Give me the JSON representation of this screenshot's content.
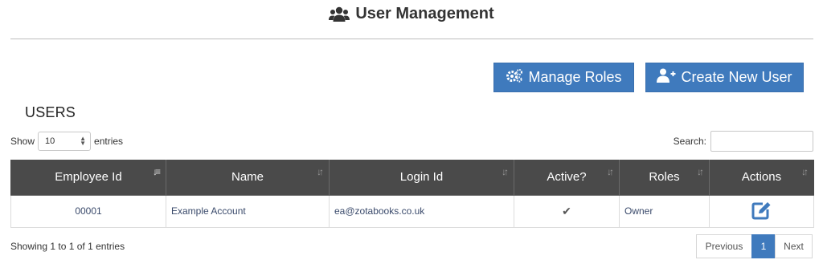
{
  "page": {
    "title": "User Management",
    "title_icon": "users-icon"
  },
  "actions": {
    "manage_roles_label": "Manage Roles",
    "manage_roles_icon": "gears-icon",
    "create_user_label": "Create New User",
    "create_user_icon": "user-plus-icon"
  },
  "section": {
    "title": "USERS"
  },
  "length_menu": {
    "prefix": "Show",
    "value": "10",
    "suffix": "entries"
  },
  "search": {
    "label": "Search:",
    "value": ""
  },
  "table": {
    "columns": [
      "Employee Id",
      "Name",
      "Login Id",
      "Active?",
      "Roles",
      "Actions"
    ],
    "sorted_column": "Employee Id",
    "rows": [
      {
        "employee_id": "00001",
        "name": "Example Account",
        "login_id": "ea@zotabooks.co.uk",
        "active": "✔",
        "roles": "Owner",
        "action_icon": "edit-icon"
      }
    ]
  },
  "footer": {
    "info": "Showing 1 to 1 of 1 entries",
    "prev_label": "Previous",
    "current_page": "1",
    "next_label": "Next"
  },
  "colors": {
    "primary": "#3f7abd",
    "header_bg": "#4a4a4a",
    "link_text": "#3a4a6b"
  }
}
